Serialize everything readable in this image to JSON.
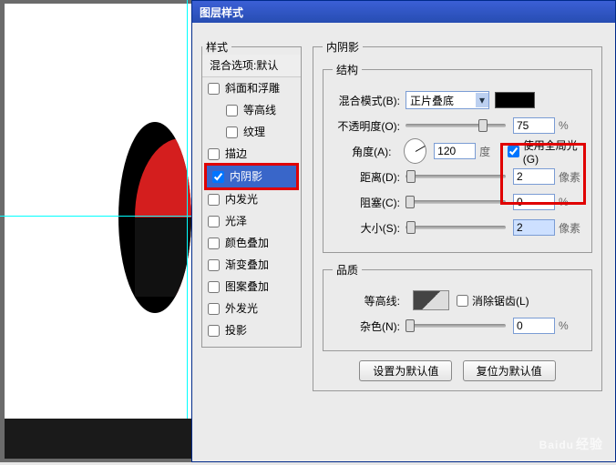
{
  "dialog": {
    "title": "图层样式"
  },
  "styles": {
    "legend": "样式",
    "blend_options": "混合选项:默认",
    "bevel": "斜面和浮雕",
    "contour": "等高线",
    "texture": "纹理",
    "stroke": "描边",
    "inner_shadow": "内阴影",
    "inner_glow": "内发光",
    "satin": "光泽",
    "color_overlay": "颜色叠加",
    "gradient_overlay": "渐变叠加",
    "pattern_overlay": "图案叠加",
    "outer_glow": "外发光",
    "drop_shadow": "投影"
  },
  "panel": {
    "title": "内阴影",
    "structure": {
      "legend": "结构",
      "blend_mode_label": "混合模式(B):",
      "blend_mode_value": "正片叠底",
      "opacity_label": "不透明度(O):",
      "opacity_value": "75",
      "opacity_unit": "%",
      "angle_label": "角度(A):",
      "angle_value": "120",
      "angle_unit": "度",
      "global_light": "使用全局光(G)",
      "distance_label": "距离(D):",
      "distance_value": "2",
      "distance_unit": "像素",
      "choke_label": "阻塞(C):",
      "choke_value": "0",
      "choke_unit": "%",
      "size_label": "大小(S):",
      "size_value": "2",
      "size_unit": "像素"
    },
    "quality": {
      "legend": "品质",
      "contour_label": "等高线:",
      "antialias": "消除锯齿(L)",
      "noise_label": "杂色(N):",
      "noise_value": "0",
      "noise_unit": "%"
    },
    "buttons": {
      "make_default": "设置为默认值",
      "reset_default": "复位为默认值"
    }
  },
  "watermark": {
    "main": "Baidu",
    "sub": "经验"
  }
}
